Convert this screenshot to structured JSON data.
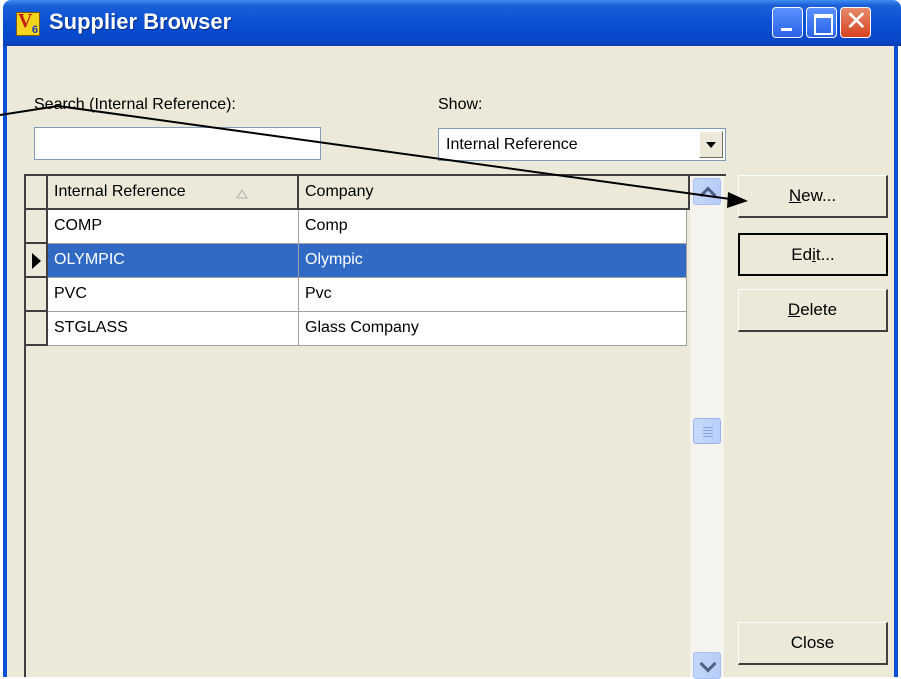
{
  "window": {
    "title": "Supplier Browser",
    "app_icon": "v6-app-icon",
    "controls": [
      "minimize-icon",
      "maximize-icon",
      "close-icon"
    ]
  },
  "search": {
    "label": "Search (Internal Reference):",
    "value": ""
  },
  "show": {
    "label": "Show:",
    "selected": "Internal Reference"
  },
  "grid": {
    "columns": [
      {
        "label": "Internal Reference",
        "sort_icon": "sort-ascending-icon"
      },
      {
        "label": "Company"
      }
    ],
    "rows": [
      {
        "ref": "COMP",
        "company": "Comp",
        "selected": false
      },
      {
        "ref": "OLYMPIC",
        "company": "Olympic",
        "selected": true
      },
      {
        "ref": "PVC",
        "company": "Pvc",
        "selected": false
      },
      {
        "ref": "STGLASS",
        "company": "Glass Company",
        "selected": false
      }
    ]
  },
  "buttons": {
    "new_prefix": "N",
    "new_rest": "ew...",
    "edit_prefix": "E",
    "edit_mid": "d",
    "edit_u": "i",
    "edit_rest": "t...",
    "delete_prefix": "D",
    "delete_rest": "elete",
    "close": "Close"
  },
  "colors": {
    "titlebar": "#0a4fd3",
    "selection": "#316ac5",
    "face": "#ece9d8"
  }
}
